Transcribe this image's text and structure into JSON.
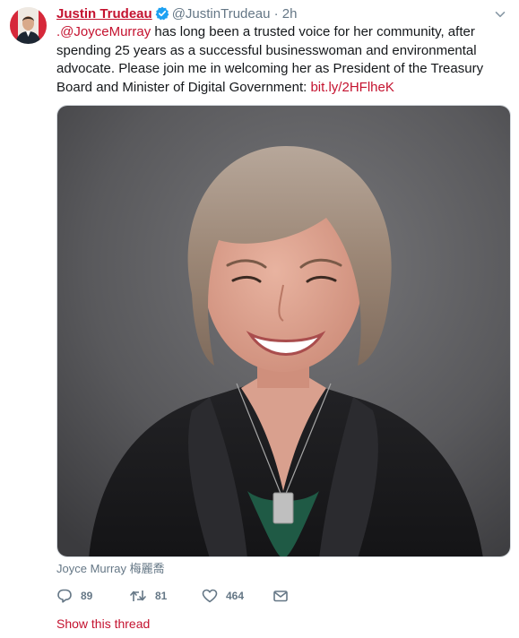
{
  "author": {
    "name": "Justin Trudeau",
    "handle": "@JustinTrudeau",
    "separator": "·",
    "time": "2h",
    "verified": true
  },
  "tweet": {
    "mention": ".@JoyceMurray",
    "text": " has long been a trusted voice for her community, after spending 25 years as a successful businesswoman and environmental advocate. Please join me in welcoming her as President of the Treasury Board and Minister of Digital Government: ",
    "link": "bit.ly/2HFlheK"
  },
  "media": {
    "caption": "Joyce Murray 梅麗喬"
  },
  "actions": {
    "reply_count": "89",
    "retweet_count": "81",
    "like_count": "464"
  },
  "thread": {
    "label": "Show this thread"
  },
  "colors": {
    "accent": "#c4122f",
    "muted": "#657786",
    "text": "#14171a",
    "verified": "#1da1f2"
  },
  "icons": {
    "reply": "reply-icon",
    "retweet": "retweet-icon",
    "like": "heart-icon",
    "dm": "envelope-icon",
    "more": "chevron-down-icon",
    "verified": "verified-badge-icon"
  }
}
